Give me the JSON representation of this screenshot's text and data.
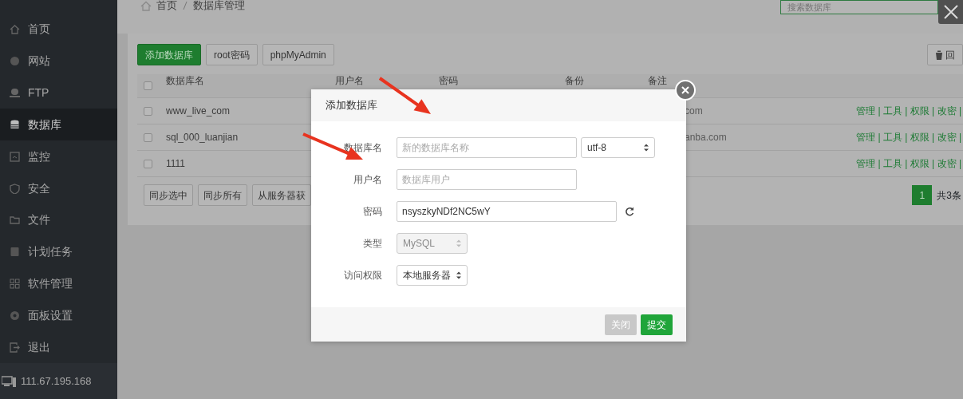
{
  "sidebar": {
    "items": [
      {
        "label": "首页",
        "selected": false
      },
      {
        "label": "网站",
        "selected": false
      },
      {
        "label": "FTP",
        "selected": false
      },
      {
        "label": "数据库",
        "selected": true
      },
      {
        "label": "监控",
        "selected": false
      },
      {
        "label": "安全",
        "selected": false
      },
      {
        "label": "文件",
        "selected": false
      },
      {
        "label": "计划任务",
        "selected": false
      },
      {
        "label": "软件管理",
        "selected": false
      },
      {
        "label": "面板设置",
        "selected": false
      },
      {
        "label": "退出",
        "selected": false
      }
    ],
    "server_ip": "111.67.195.168"
  },
  "breadcrumb": [
    "首页",
    "数据库管理"
  ],
  "search": {
    "placeholder": "搜索数据库"
  },
  "toolbar": {
    "buttons": [
      {
        "label": "添加数据库",
        "kind": "primary"
      },
      {
        "label": "root密码",
        "kind": "default"
      },
      {
        "label": "phpMyAdmin",
        "kind": "default"
      }
    ],
    "recycle_button": "回"
  },
  "table": {
    "all_checked": false,
    "columns": [
      "数据库名",
      "用户名",
      "密码",
      "备份",
      "备注"
    ],
    "rows": [
      {
        "name": "www_live_com",
        "remark": "com",
        "actions": "管理 | 工具 | 权限 | 改密 |",
        "checked": false
      },
      {
        "name": "sql_000_luanjian",
        "remark": "anba.com",
        "actions": "管理 | 工具 | 权限 | 改密 |",
        "checked": false
      },
      {
        "name": "1111",
        "actions": "管理 | 工具 | 权限 | 改密 |",
        "checked": false
      }
    ]
  },
  "bulk_buttons": [
    "同步选中",
    "同步所有",
    "从服务器获"
  ],
  "pagination": {
    "pages": [
      {
        "label": "1",
        "selected": true
      }
    ],
    "total": "共3条"
  },
  "dialog": {
    "title": "添加数据库",
    "fields": [
      {
        "label": "数据库名",
        "kind": "text",
        "placeholder": "新的数据库名称",
        "charset": "utf-8"
      },
      {
        "label": "用户名",
        "kind": "text",
        "placeholder": "数据库用户"
      },
      {
        "label": "密码",
        "kind": "password",
        "value": "nsyszkyNDf2NC5wY"
      },
      {
        "label": "类型",
        "kind": "select",
        "value": "MySQL",
        "disabled": true
      },
      {
        "label": "访问权限",
        "kind": "select",
        "value": "本地服务器",
        "disabled": false
      }
    ],
    "buttons": [
      {
        "label": "关闭",
        "kind": "secondary"
      },
      {
        "label": "提交",
        "kind": "primary"
      }
    ]
  }
}
